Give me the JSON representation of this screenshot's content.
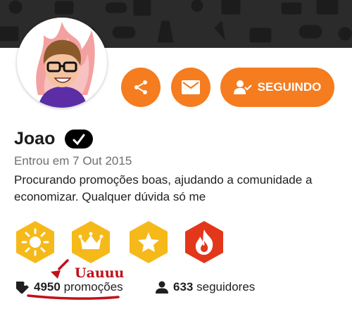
{
  "profile": {
    "name": "Joao",
    "joined": "Entrou em 7 Out 2015",
    "bio": "Procurando promoções boas, ajudando a comunidade a economizar. Qualquer dúvida só me",
    "verified_icon": "check-icon"
  },
  "actions": {
    "share_icon": "share-icon",
    "message_icon": "mail-icon",
    "follow_label": "SEGUINDO",
    "follow_icon": "person-check-icon"
  },
  "badges": [
    {
      "icon": "sun-icon",
      "color": "#f6b91a"
    },
    {
      "icon": "crown-icon",
      "color": "#f6b91a"
    },
    {
      "icon": "star-icon",
      "color": "#f6b91a"
    },
    {
      "icon": "flame-icon",
      "color": "#e2371a"
    }
  ],
  "stats": {
    "deals_count": "4950",
    "deals_label": "promoções",
    "followers_count": "633",
    "followers_label": "seguidores"
  },
  "annotation": {
    "text": "Uauuu",
    "color": "#c0111b"
  },
  "colors": {
    "accent": "#f57c1f",
    "banner": "#2b2b2b"
  }
}
